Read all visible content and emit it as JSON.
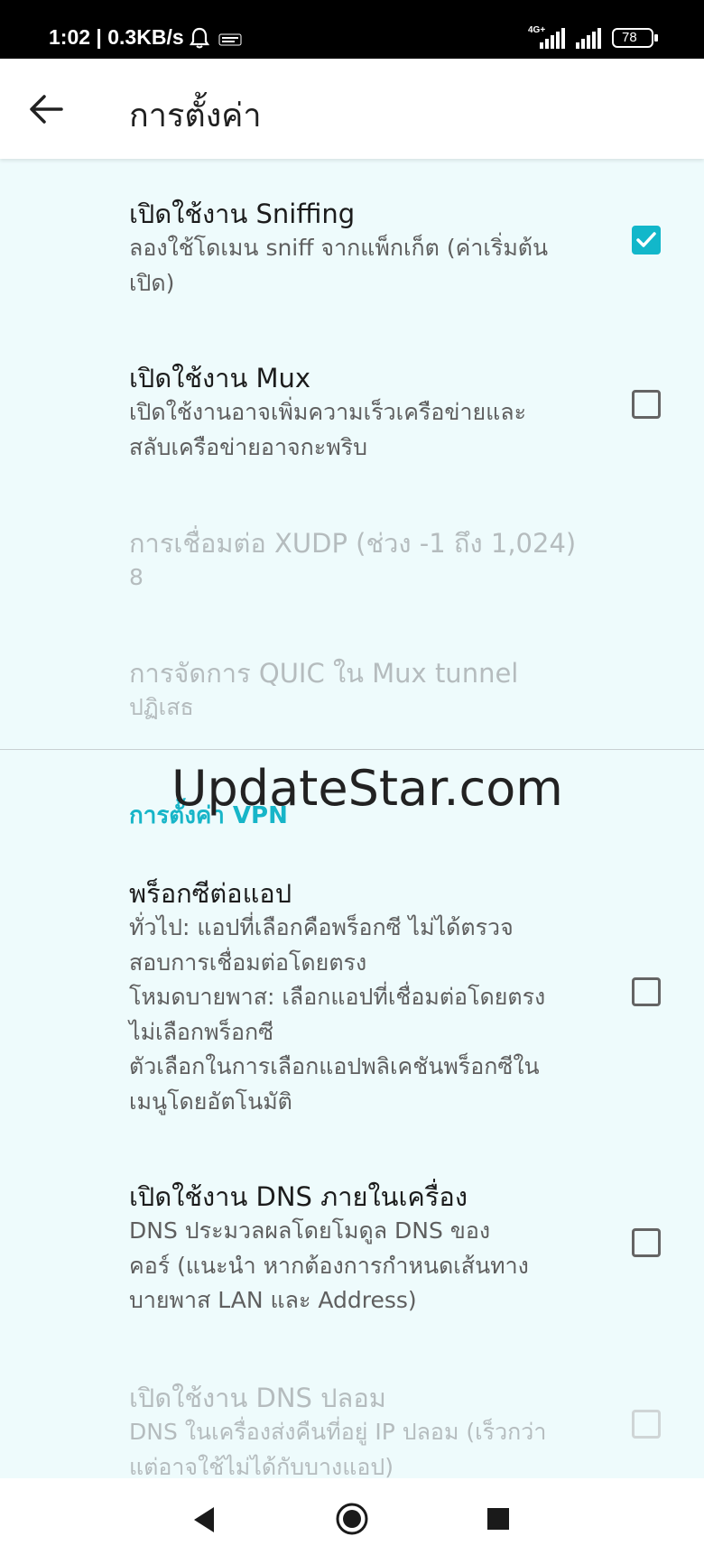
{
  "status_bar": {
    "time_speed": "1:02 | 0.3KB/s",
    "network_type": "4G+",
    "battery": "78"
  },
  "app_bar": {
    "title": "การตั้งค่า"
  },
  "preferences": [
    {
      "title": "เปิดใช้งาน Sniffing",
      "summary": "ลองใช้โดเมน sniff จากแพ็กเก็ต (ค่าเริ่มต้น\nเปิด)",
      "checked": true,
      "enabled": true
    },
    {
      "title": "เปิดใช้งาน Mux",
      "summary": "เปิดใช้งานอาจเพิ่มความเร็วเครือข่ายและ\nสลับเครือข่ายอาจกะพริบ",
      "checked": false,
      "enabled": true
    },
    {
      "title": "การเชื่อมต่อ XUDP (ช่วง -1 ถึง 1,024)",
      "summary": "8",
      "enabled": false
    },
    {
      "title": "การจัดการ QUIC ใน Mux tunnel",
      "summary": "ปฏิเสธ",
      "enabled": false
    }
  ],
  "vpn_section": {
    "header": "การตั้งค่า VPN",
    "watermark": "UpdateStar.com",
    "items": [
      {
        "title": "พร็อกซีต่อแอป",
        "summary": "ทั่วไป: แอปที่เลือกคือพร็อกซี ไม่ได้ตรวจ\nสอบการเชื่อมต่อโดยตรง\nโหมดบายพาส: เลือกแอปที่เชื่อมต่อโดยตรง\nไม่เลือกพร็อกซี\nตัวเลือกในการเลือกแอปพลิเคชันพร็อกซีใน\nเมนูโดยอัตโนมัติ",
        "checked": false,
        "enabled": true
      },
      {
        "title": "เปิดใช้งาน DNS ภายในเครื่อง",
        "summary": "DNS ประมวลผลโดยโมดูล DNS ของ\nคอร์ (แนะนำ หากต้องการกำหนดเส้นทาง\nบายพาส LAN และ Address)",
        "checked": false,
        "enabled": true
      },
      {
        "title": "เปิดใช้งาน DNS ปลอม",
        "summary": "DNS ในเครื่องส่งคืนที่อยู่ IP ปลอม (เร็วกว่า\nแต่อาจใช้ไม่ได้กับบางแอป)",
        "checked": false,
        "enabled": false
      }
    ]
  },
  "colors": {
    "accent": "#12b7ca",
    "background": "#eefbfc",
    "disabled_text": "#b5bcbe"
  }
}
